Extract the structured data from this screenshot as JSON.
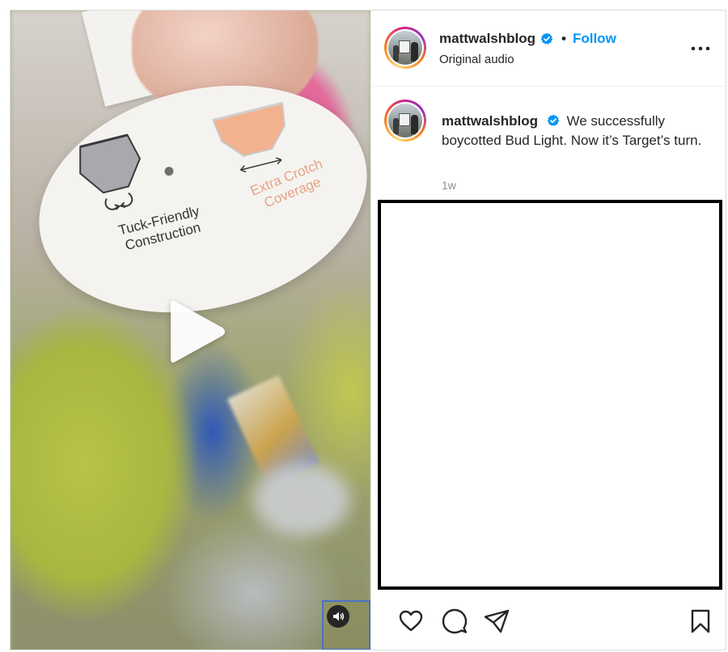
{
  "post": {
    "media": {
      "tag": {
        "left_line1": "Tuck-Friendly",
        "left_line2": "Construction",
        "right_line1": "Extra Crotch",
        "right_line2": "Coverage"
      },
      "play_icon": "play-icon",
      "audio_icon": "speaker-icon"
    },
    "header": {
      "username": "mattwalshblog",
      "separator": "•",
      "follow_label": "Follow",
      "subtitle": "Original audio",
      "more_icon": "more-icon"
    },
    "caption": {
      "username": "mattwalshblog",
      "text": "We successfully boycotted Bud Light. Now it’s Target’s turn.",
      "time": "1w"
    },
    "actions": {
      "like_icon": "heart-icon",
      "comment_icon": "comment-icon",
      "share_icon": "share-icon",
      "save_icon": "bookmark-icon"
    },
    "colors": {
      "follow": "#0095f6",
      "verified": "#0095f6",
      "text": "#262626",
      "secondary": "#8e8e8e"
    }
  }
}
